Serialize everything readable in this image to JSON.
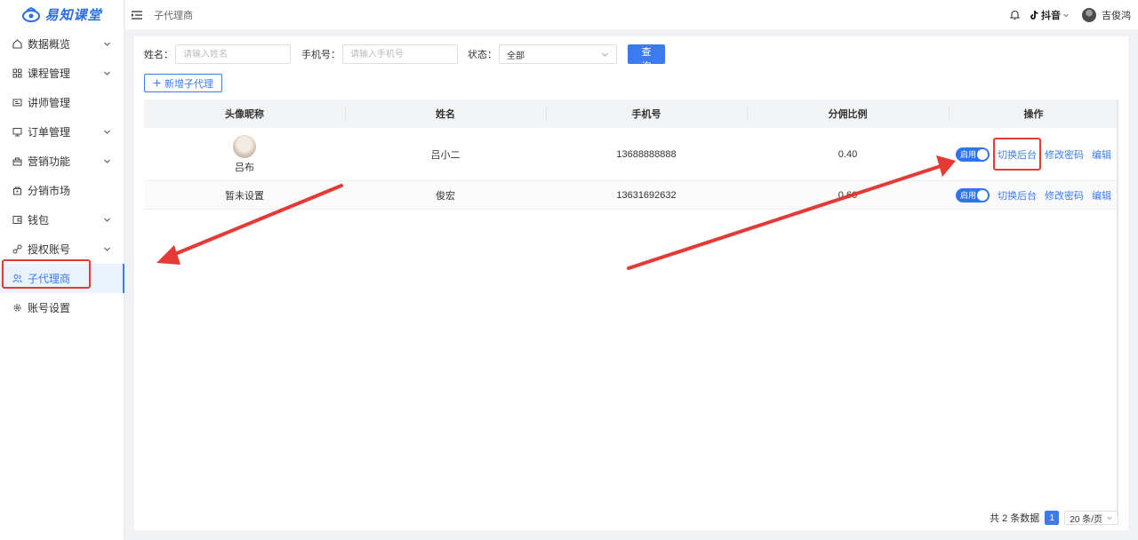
{
  "app": {
    "brand": "易知课堂"
  },
  "sidebar": {
    "items": [
      {
        "label": "数据概览",
        "icon": "home-icon",
        "has_children": true
      },
      {
        "label": "课程管理",
        "icon": "grid-icon",
        "has_children": true
      },
      {
        "label": "讲师管理",
        "icon": "id-card-icon",
        "has_children": false
      },
      {
        "label": "订单管理",
        "icon": "order-icon",
        "has_children": true
      },
      {
        "label": "营销功能",
        "icon": "gift-icon",
        "has_children": true
      },
      {
        "label": "分销市场",
        "icon": "bag-icon",
        "has_children": false
      },
      {
        "label": "钱包",
        "icon": "wallet-icon",
        "has_children": true
      },
      {
        "label": "授权账号",
        "icon": "link-icon",
        "has_children": true
      },
      {
        "label": "子代理商",
        "icon": "users-icon",
        "has_children": false,
        "active": true
      },
      {
        "label": "账号设置",
        "icon": "gear-icon",
        "has_children": false
      }
    ]
  },
  "header": {
    "breadcrumb": "子代理商",
    "platform": "抖音",
    "user_name": "吉俊鸿"
  },
  "search": {
    "name_label": "姓名：",
    "name_placeholder": "请输入姓名",
    "phone_label": "手机号：",
    "phone_placeholder": "请输入手机号",
    "status_label": "状态：",
    "status_value": "全部",
    "query_button": "查 询",
    "add_button": "新增子代理"
  },
  "table": {
    "columns": [
      "头像昵称",
      "姓名",
      "手机号",
      "分佣比例",
      "操作"
    ],
    "rows": [
      {
        "nickname": "吕布",
        "has_avatar": true,
        "name": "吕小二",
        "phone": "13688888888",
        "ratio": "0.40",
        "status": "启用",
        "ops": [
          "切换后台",
          "修改密码",
          "编辑"
        ]
      },
      {
        "nickname": "暂未设置",
        "has_avatar": false,
        "name": "俊宏",
        "phone": "13631692632",
        "ratio": "0.60",
        "status": "启用",
        "ops": [
          "切换后台",
          "修改密码",
          "编辑"
        ]
      }
    ]
  },
  "pagination": {
    "total_text": "共 2 条数据",
    "current_page": "1",
    "page_size": "20 条/页"
  },
  "annotations": {
    "color": "#e53935"
  },
  "colors": {
    "accent": "#3a7cf0",
    "switch_on": "#2f74e8"
  }
}
